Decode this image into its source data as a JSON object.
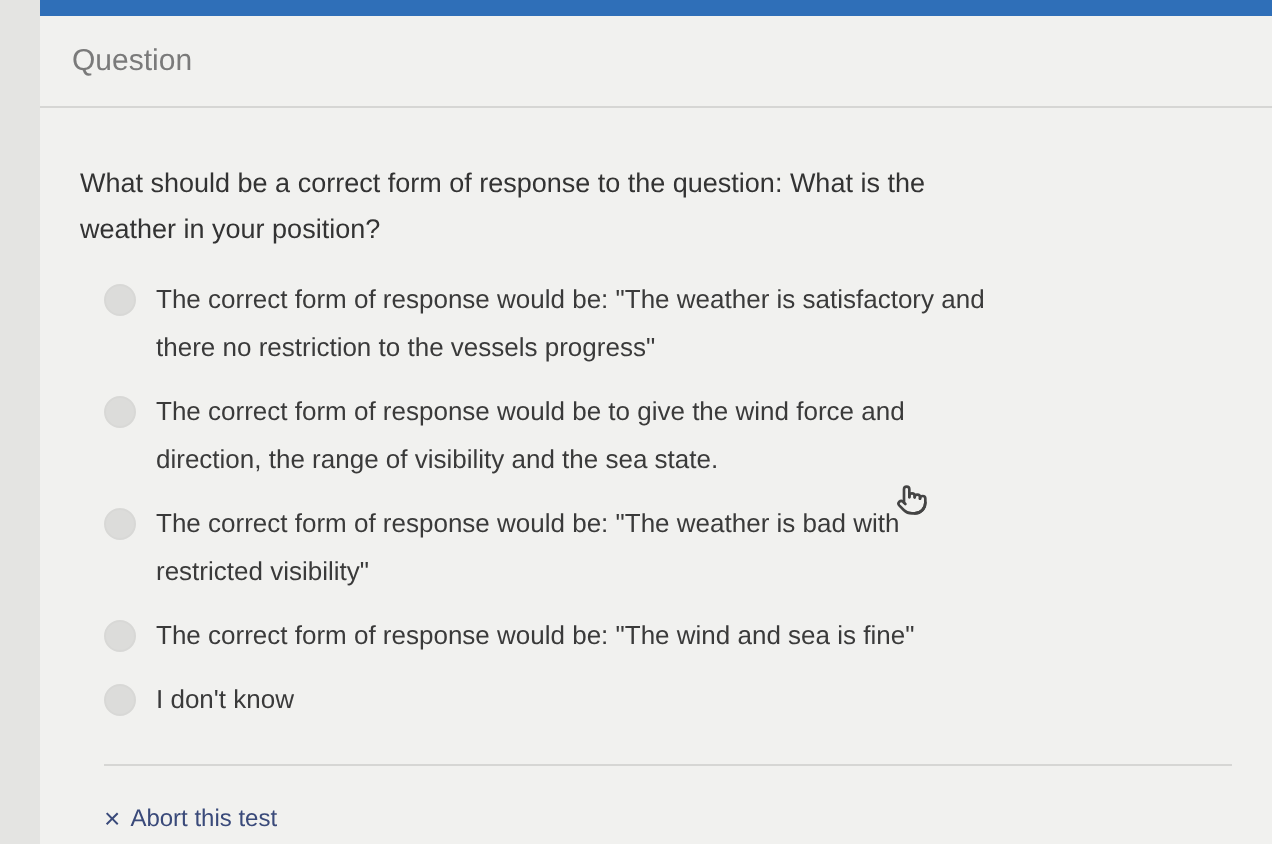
{
  "header": {
    "title": "Question"
  },
  "question": "What should be a correct form of response to the question: What is the weather in your position?",
  "options": [
    {
      "label": "The correct form of response would be: \"The weather is satisfactory and there no restriction to the vessels progress\"",
      "selected": false
    },
    {
      "label": "The correct form of response would be to give the wind force and direction, the range of visibility and the sea state.",
      "selected": false
    },
    {
      "label": "The correct form of response would be: \"The weather is bad with restricted visibility\"",
      "selected": false
    },
    {
      "label": "The correct form of response would be: \"The wind and sea is fine\"",
      "selected": false
    },
    {
      "label": "I don't know",
      "selected": false
    }
  ],
  "abort": {
    "icon": "×",
    "label": "Abort this test"
  }
}
